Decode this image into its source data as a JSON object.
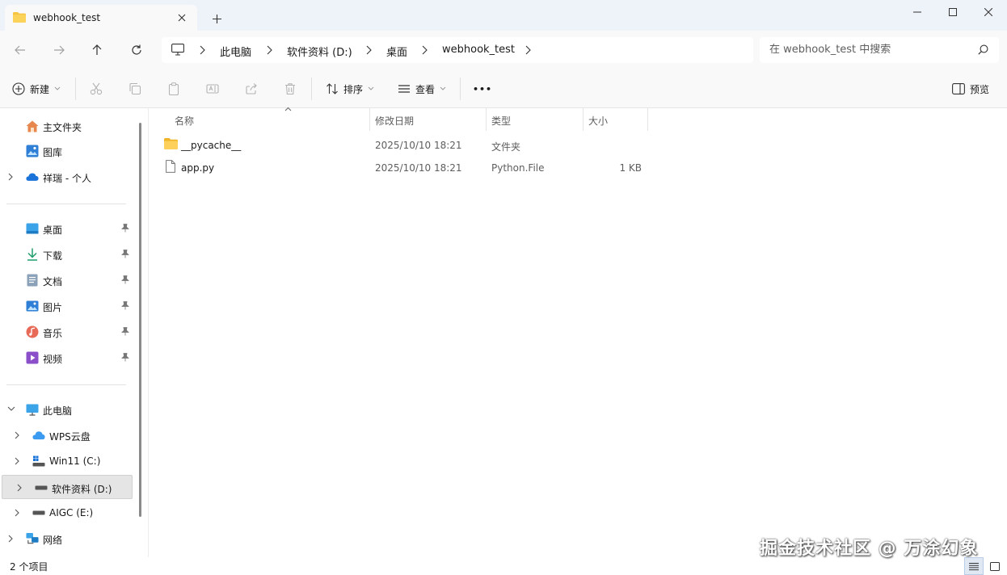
{
  "window": {
    "tab_title": "webhook_test",
    "new_tab_symbol": "+"
  },
  "nav": {
    "breadcrumbs": [
      "此电脑",
      "软件资料 (D:)",
      "桌面",
      "webhook_test"
    ],
    "search_placeholder": "在 webhook_test 中搜索"
  },
  "toolbar": {
    "new_label": "新建",
    "sort_label": "排序",
    "view_label": "查看",
    "more_label": "•••",
    "preview_label": "预览"
  },
  "sidebar": {
    "quick": [
      {
        "label": "主文件夹",
        "icon": "home-icon"
      },
      {
        "label": "图库",
        "icon": "gallery-icon"
      },
      {
        "label": "祥瑞 - 个人",
        "icon": "onedrive-icon"
      }
    ],
    "pinned": [
      {
        "label": "桌面",
        "icon": "desktop-icon"
      },
      {
        "label": "下载",
        "icon": "download-icon"
      },
      {
        "label": "文档",
        "icon": "documents-icon"
      },
      {
        "label": "图片",
        "icon": "pictures-icon"
      },
      {
        "label": "音乐",
        "icon": "music-icon"
      },
      {
        "label": "视频",
        "icon": "videos-icon"
      }
    ],
    "pc_label": "此电脑",
    "drives": [
      {
        "label": "WPS云盘",
        "icon": "cloud-icon"
      },
      {
        "label": "Win11 (C:)",
        "icon": "windows-drive-icon"
      },
      {
        "label": "软件资料 (D:)",
        "icon": "drive-icon",
        "selected": true
      },
      {
        "label": "AIGC (E:)",
        "icon": "drive-icon"
      }
    ],
    "network_label": "网络"
  },
  "columns": {
    "name": "名称",
    "date": "修改日期",
    "type": "类型",
    "size": "大小"
  },
  "files": [
    {
      "name": "__pycache__",
      "date": "2025/10/10 18:21",
      "type": "文件夹",
      "size": "",
      "icon": "folder-icon"
    },
    {
      "name": "app.py",
      "date": "2025/10/10 18:21",
      "type": "Python.File",
      "size": "1 KB",
      "icon": "file-icon"
    }
  ],
  "status": {
    "item_count": "2 个项目"
  },
  "watermark": "掘金技术社区 @ 万涂幻象",
  "colors": {
    "folder": "#f8c443",
    "accent": "#0067c0",
    "titlebar": "#eef2f9"
  }
}
